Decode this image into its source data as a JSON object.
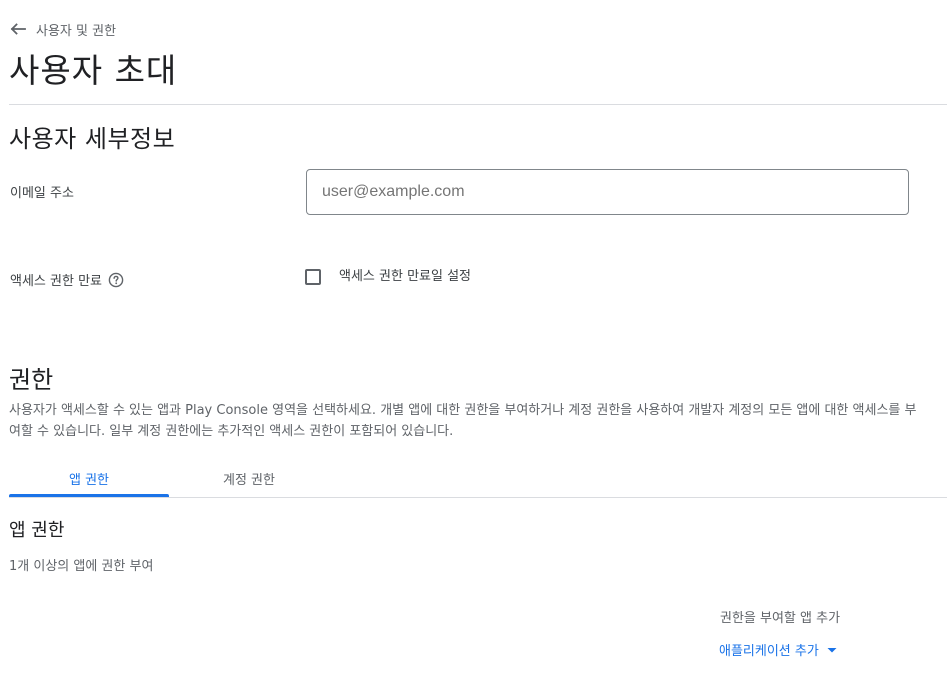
{
  "breadcrumb": {
    "back_label": "사용자 및 권한"
  },
  "page": {
    "title": "사용자 초대"
  },
  "user_details": {
    "title": "사용자 세부정보",
    "email_label": "이메일 주소",
    "email_placeholder": "user@example.com",
    "email_value": "",
    "expiry_label": "액세스 권한 만료",
    "expiry_checkbox_label": "액세스 권한 만료일 설정",
    "expiry_checked": false
  },
  "permissions": {
    "title": "권한",
    "description": "사용자가 액세스할 수 있는 앱과 Play Console 영역을 선택하세요. 개별 앱에 대한 권한을 부여하거나 계정 권한을 사용하여 개발자 계정의 모든 앱에 대한 액세스를 부여할 수 있습니다. 일부 계정 권한에는 추가적인 액세스 권한이 포함되어 있습니다.",
    "tabs": [
      {
        "label": "앱 권한",
        "active": true
      },
      {
        "label": "계정 권한",
        "active": false
      }
    ]
  },
  "app_permissions": {
    "title": "앱 권한",
    "subtitle": "1개 이상의 앱에 권한 부여",
    "add_app_label": "권한을 부여할 앱 추가",
    "add_app_dropdown": "애플리케이션 추가"
  },
  "icons": {
    "back": "arrow-left-icon",
    "help": "help-circle-icon",
    "dropdown": "caret-down-icon"
  },
  "colors": {
    "accent": "#1a73e8",
    "text_primary": "#202124",
    "text_secondary": "#5f6368",
    "divider": "#dadce0"
  }
}
